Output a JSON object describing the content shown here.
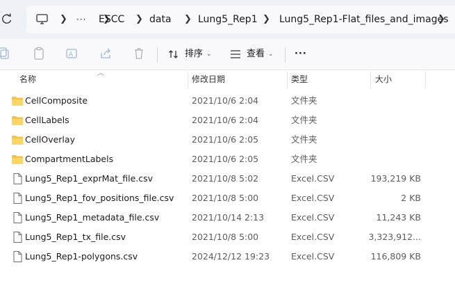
{
  "breadcrumb": {
    "items": [
      "ESCC",
      "data",
      "Lung5_Rep1",
      "Lung5_Rep1-Flat_files_and_images"
    ],
    "more": "···"
  },
  "toolbar": {
    "sort_label": "排序",
    "view_label": "查看",
    "more_label": "···"
  },
  "columns": {
    "name": "名称",
    "date": "修改日期",
    "type": "类型",
    "size": "大小"
  },
  "files": [
    {
      "name": "CellComposite",
      "date": "2021/10/6 2:04",
      "type": "文件夹",
      "size": "",
      "kind": "folder"
    },
    {
      "name": "CellLabels",
      "date": "2021/10/6 2:04",
      "type": "文件夹",
      "size": "",
      "kind": "folder"
    },
    {
      "name": "CellOverlay",
      "date": "2021/10/6 2:05",
      "type": "文件夹",
      "size": "",
      "kind": "folder"
    },
    {
      "name": "CompartmentLabels",
      "date": "2021/10/6 2:05",
      "type": "文件夹",
      "size": "",
      "kind": "folder"
    },
    {
      "name": "Lung5_Rep1_exprMat_file.csv",
      "date": "2021/10/8 5:02",
      "type": "Excel.CSV",
      "size": "193,219 KB",
      "kind": "file"
    },
    {
      "name": "Lung5_Rep1_fov_positions_file.csv",
      "date": "2021/10/8 5:00",
      "type": "Excel.CSV",
      "size": "2 KB",
      "kind": "file"
    },
    {
      "name": "Lung5_Rep1_metadata_file.csv",
      "date": "2021/10/14 2:13",
      "type": "Excel.CSV",
      "size": "11,243 KB",
      "kind": "file"
    },
    {
      "name": "Lung5_Rep1_tx_file.csv",
      "date": "2021/10/8 5:00",
      "type": "Excel.CSV",
      "size": "3,323,912...",
      "kind": "file"
    },
    {
      "name": "Lung5_Rep1-polygons.csv",
      "date": "2024/12/12 19:23",
      "type": "Excel.CSV",
      "size": "116,809 KB",
      "kind": "file"
    }
  ],
  "colors": {
    "folder": "#f5c342",
    "accent": "#0067c0"
  }
}
